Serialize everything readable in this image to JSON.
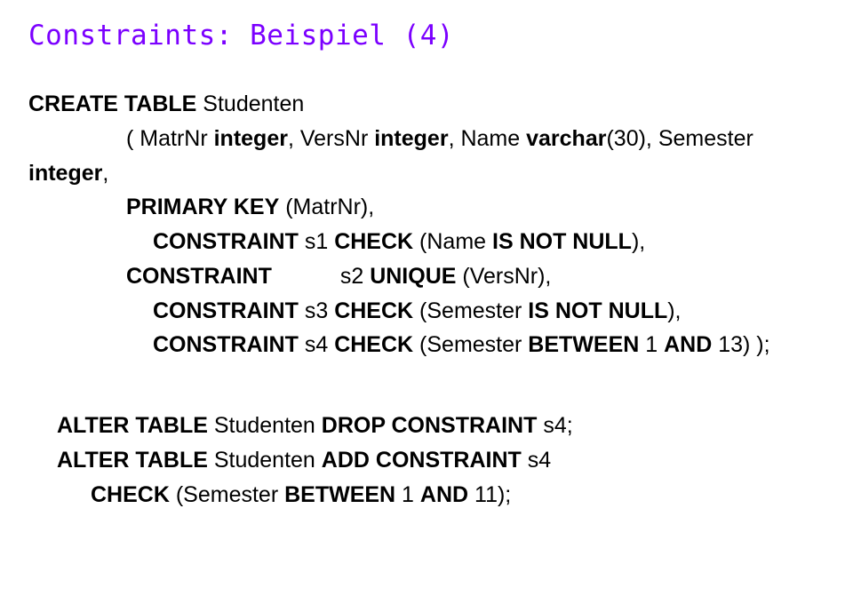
{
  "title": "Constraints: Beispiel (4)",
  "s1": {
    "kw_create": "CREATE TABLE",
    "tbl": " Studenten"
  },
  "s2": {
    "text": "( MatrNr ",
    "kw": "integer",
    "t2": ",  VersNr ",
    "kw2": "integer",
    "t3": ", Name ",
    "kw3": "varchar",
    "t4": "(30),  Semester"
  },
  "s3": {
    "kw": "integer",
    "t": ","
  },
  "s4": {
    "kw": "PRIMARY KEY",
    "t": " (MatrNr),"
  },
  "s5": {
    "kw": "CONSTRAINT",
    "nm": " s1 ",
    "kw2": "CHECK",
    "t": " (Name ",
    "kw3": "IS NOT NULL",
    "t2": "),"
  },
  "s6": {
    "kw": "CONSTRAINT",
    "nm": " s2 ",
    "kw2": "UNIQUE",
    "t": " (VersNr),"
  },
  "s7": {
    "kw": "CONSTRAINT",
    "nm": " s3 ",
    "kw2": "CHECK",
    "t": " (Semester ",
    "kw3": "IS NOT NULL",
    "t2": "),"
  },
  "s8": {
    "kw": "CONSTRAINT",
    "nm": " s4 ",
    "kw2": "CHECK",
    "t": " (Semester ",
    "kw3": "BETWEEN",
    "t2": " 1 ",
    "kw4": "AND",
    "t3": " 13)     );"
  },
  "a1": {
    "kw": "ALTER TABLE",
    "t": " Studenten ",
    "kw2": "DROP CONSTRAINT",
    "t2": " s4;"
  },
  "a2": {
    "kw": "ALTER TABLE",
    "t": " Studenten ",
    "kw2": "ADD CONSTRAINT",
    "t2": " s4"
  },
  "a3": {
    "kw": "CHECK",
    "t": " (Semester ",
    "kw2": "BETWEEN",
    "t2": " 1 ",
    "kw3": "AND",
    "t3": " 11);"
  }
}
